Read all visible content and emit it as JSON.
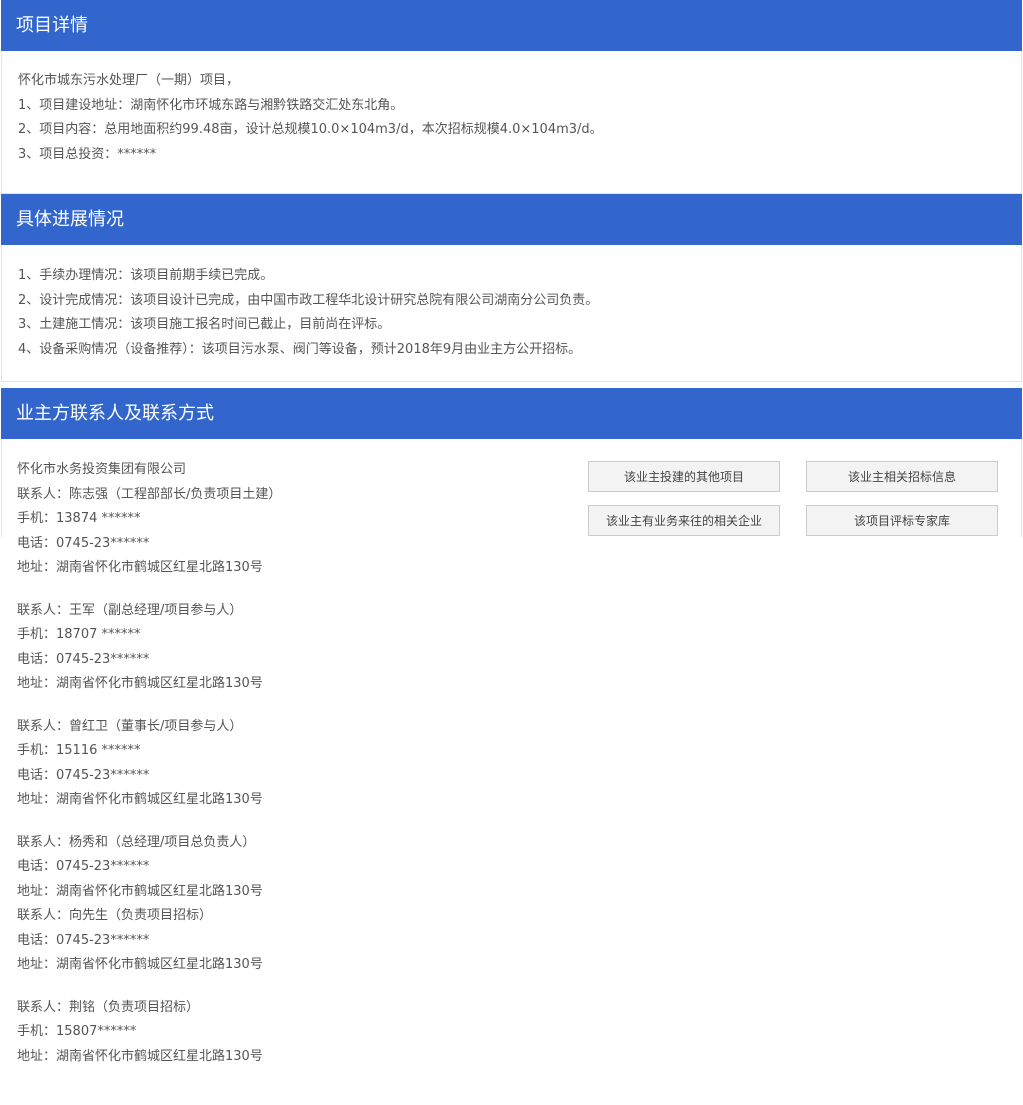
{
  "project_detail": {
    "title": "项目详情",
    "lines": [
      "怀化市城东污水处理厂（一期）项目，",
      "1、项目建设地址：湖南怀化市环城东路与湘黔铁路交汇处东北角。",
      "2、项目内容：总用地面积约99.48亩，设计总规模10.0×104m3/d，本次招标规模4.0×104m3/d。",
      "3、项目总投资：******"
    ]
  },
  "progress": {
    "title": "具体进展情况",
    "lines": [
      "1、手续办理情况：该项目前期手续已完成。",
      "2、设计完成情况：该项目设计已完成，由中国市政工程华北设计研究总院有限公司湖南分公司负责。",
      "3、土建施工情况：该项目施工报名时间已截止，目前尚在评标。",
      "4、设备采购情况（设备推荐）：该项目污水泵、阀门等设备，预计2018年9月由业主方公开招标。"
    ]
  },
  "owner_contacts": {
    "title": "业主方联系人及联系方式",
    "company": "怀化市水务投资集团有限公司",
    "contacts": [
      {
        "person": "联系人：陈志强（工程部部长/负责项目土建）",
        "mobile": "手机：13874 ******",
        "phone": "电话：0745-23******",
        "address": "地址：湖南省怀化市鹤城区红星北路130号"
      },
      {
        "person": "联系人：王军（副总经理/项目参与人）",
        "mobile": "手机：18707 ******",
        "phone": "电话：0745-23******",
        "address": "地址：湖南省怀化市鹤城区红星北路130号"
      },
      {
        "person": "联系人：曾红卫（董事长/项目参与人）",
        "mobile": "手机：15116 ******",
        "phone": "电话：0745-23******",
        "address": "地址：湖南省怀化市鹤城区红星北路130号"
      },
      {
        "person": "联系人：杨秀和（总经理/项目总负责人）",
        "phone": "电话：0745-23******",
        "address": "地址：湖南省怀化市鹤城区红星北路130号"
      },
      {
        "person": "联系人：向先生（负责项目招标）",
        "phone": "电话：0745-23******",
        "address": "地址：湖南省怀化市鹤城区红星北路130号"
      },
      {
        "person": "联系人：荆铭（负责项目招标）",
        "mobile": "手机：15807******",
        "address": "地址：湖南省怀化市鹤城区红星北路130号"
      }
    ],
    "buttons": {
      "other_projects": "该业主投建的其他项目",
      "tender_info": "该业主相关招标信息",
      "related_companies": "该业主有业务来往的相关企业",
      "expert_library": "该项目评标专家库"
    }
  },
  "colors": {
    "header_bg": "#3366cc",
    "header_text": "#ffffff",
    "body_text": "#555555",
    "button_bg": "#f3f3f3"
  }
}
